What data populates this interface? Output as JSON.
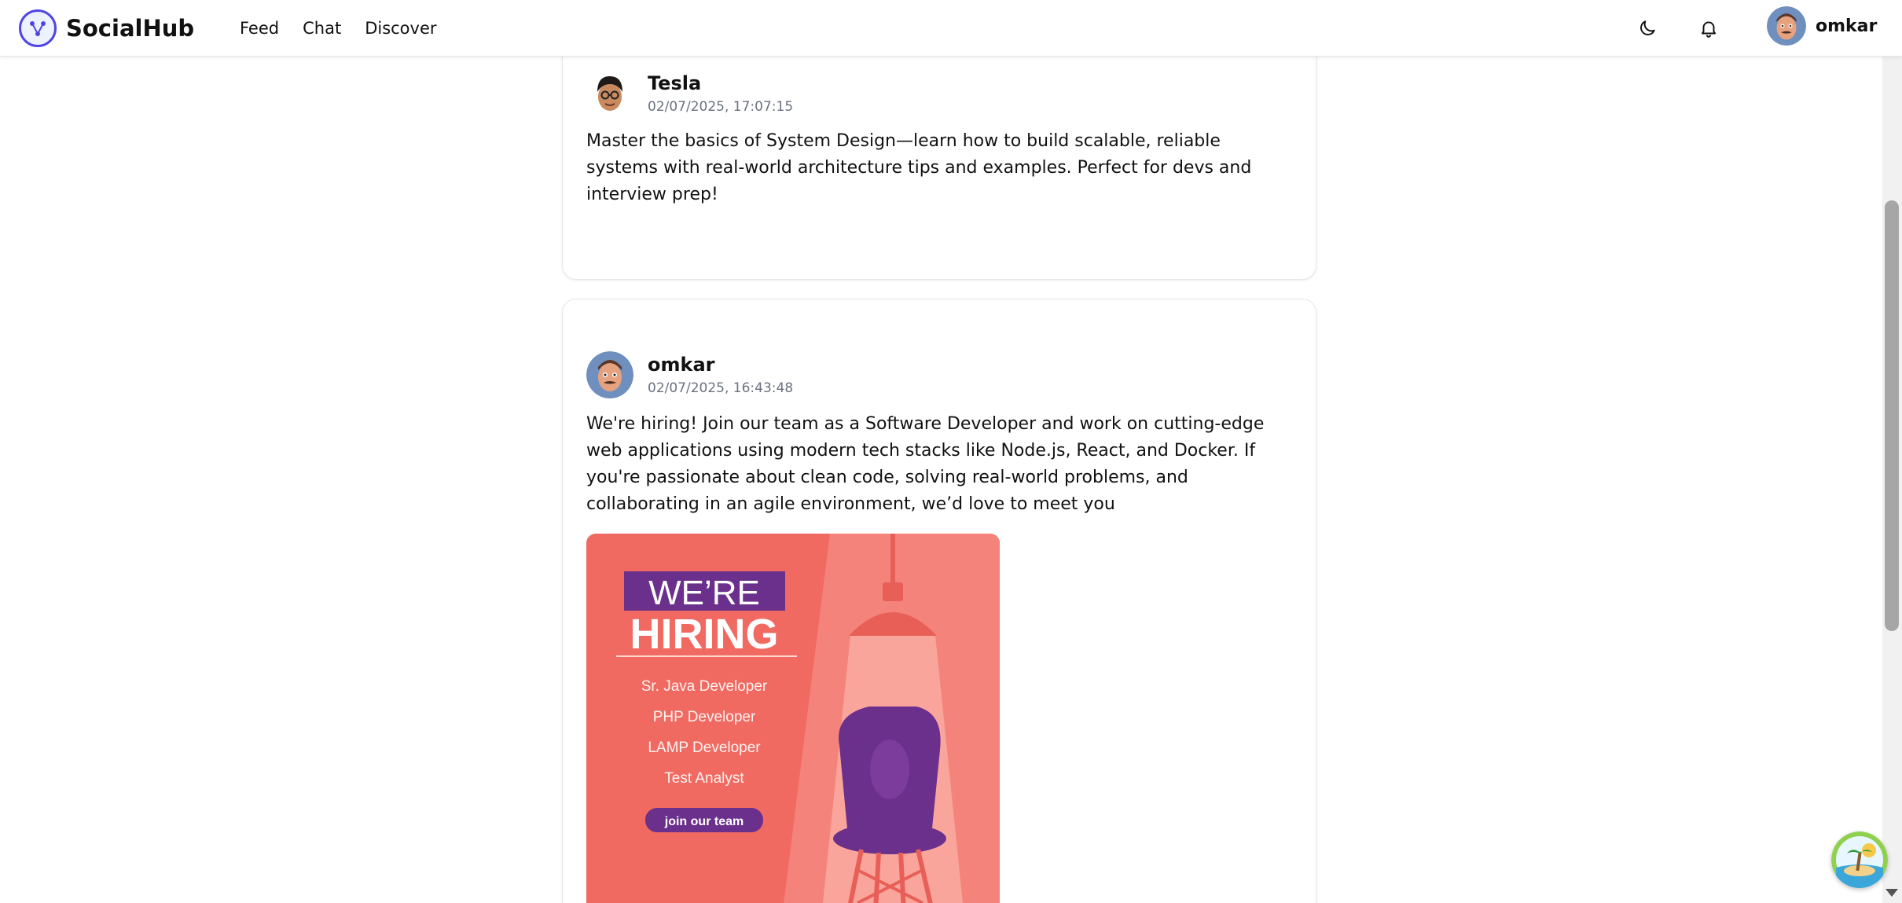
{
  "app": {
    "name": "SocialHub",
    "nav": [
      "Feed",
      "Chat",
      "Discover"
    ],
    "current_user": "omkar"
  },
  "icons": {
    "logo": "network-logo-icon",
    "theme": "moon-icon",
    "notifications": "bell-icon",
    "assistant": "island-bot-icon"
  },
  "colors": {
    "brand": "#4f46e5",
    "hiring_bg": "#f06a62",
    "hiring_purple": "#6b2f8c"
  },
  "posts": [
    {
      "author": "Tesla",
      "timestamp": "02/07/2025, 17:07:15",
      "text": "Master the basics of System Design—learn how to build scalable, reliable systems with real-world architecture tips and examples. Perfect for devs and interview prep!"
    },
    {
      "author": "omkar",
      "timestamp": "02/07/2025, 16:43:48",
      "text": "We're hiring! Join our team as a Software Developer and work on cutting-edge web applications using modern tech stacks like Node.js, React, and Docker. If you're passionate about clean code, solving real-world problems, and collaborating in an agile environment, we’d love to meet you",
      "image": {
        "headline_top": "WE’RE",
        "headline_bottom": "HIRING",
        "roles": [
          "Sr. Java Developer",
          "PHP Developer",
          "LAMP Developer",
          "Test Analyst"
        ],
        "cta": "join our team"
      }
    }
  ]
}
